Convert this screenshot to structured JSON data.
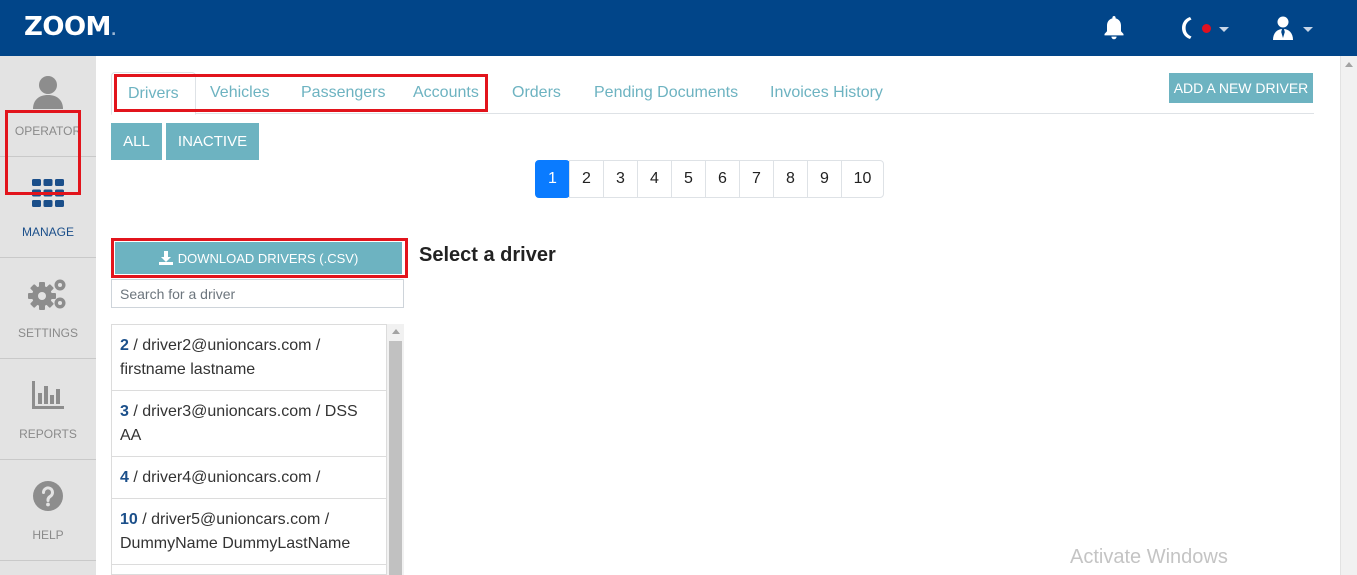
{
  "header": {
    "logo": "ZOOM",
    "logo_suffix": "."
  },
  "sidebar": {
    "items": [
      {
        "label": "OPERATOR",
        "icon": "user-icon"
      },
      {
        "label": "MANAGE",
        "icon": "grid-icon"
      },
      {
        "label": "SETTINGS",
        "icon": "gears-icon"
      },
      {
        "label": "REPORTS",
        "icon": "bar-chart-icon"
      },
      {
        "label": "HELP",
        "icon": "question-icon"
      }
    ]
  },
  "tabs": [
    "Drivers",
    "Vehicles",
    "Passengers",
    "Accounts",
    "Orders",
    "Pending Documents",
    "Invoices History"
  ],
  "add_button": "ADD A NEW DRIVER",
  "filters": {
    "all": "ALL",
    "inactive": "INACTIVE"
  },
  "pagination": [
    "1",
    "2",
    "3",
    "4",
    "5",
    "6",
    "7",
    "8",
    "9",
    "10"
  ],
  "download_button": "DOWNLOAD DRIVERS (.CSV)",
  "search": {
    "placeholder": "Search for a driver",
    "value": ""
  },
  "select_title": "Select a driver",
  "drivers": [
    {
      "id": "2",
      "text": " / driver2@unioncars.com / firstname lastname"
    },
    {
      "id": "3",
      "text": " / driver3@unioncars.com / DSS AA"
    },
    {
      "id": "4",
      "text": " / driver4@unioncars.com /"
    },
    {
      "id": "10",
      "text": " / driver5@unioncars.com / DummyName DummyLastName"
    }
  ],
  "watermark": "Activate Windows",
  "colors": {
    "header": "#014589",
    "accent": "#6db3c1",
    "highlight": "#e2141c",
    "active_page": "#0a7bff"
  }
}
